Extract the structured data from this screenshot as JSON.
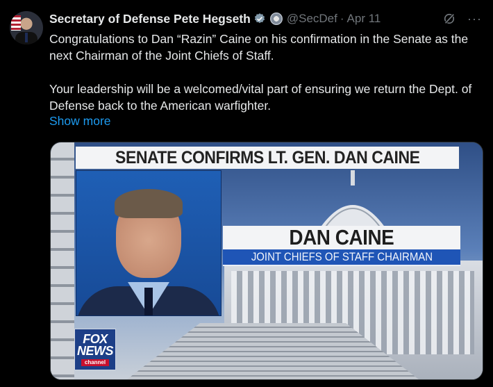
{
  "tweet": {
    "author_name": "Secretary of Defense Pete Hegseth",
    "handle": "@SecDef",
    "separator": "·",
    "date": "Apr 11",
    "paragraph_1": "Congratulations to Dan “Razin” Caine on his confirmation in the Senate as the next Chairman of the Joint Chiefs of Staff.",
    "paragraph_2": "Your leadership will be a welcomed/vital part of ensuring we return the Dept. of Defense back to the American warfighter.",
    "show_more": "Show more",
    "more_menu": "···"
  },
  "media": {
    "headline": "SENATE CONFIRMS LT. GEN. DAN CAINE",
    "name": "DAN CAINE",
    "title": "JOINT CHIEFS OF STAFF CHAIRMAN",
    "logo_line_1": "FOX",
    "logo_line_2": "NEWS",
    "logo_line_3": "channel"
  },
  "colors": {
    "background": "#000000",
    "text": "#e7e9ea",
    "muted": "#71767b",
    "link": "#1d9bf0",
    "verified": "#829aab"
  },
  "icons": [
    "avatar",
    "verified-badge-icon",
    "government-affiliation-icon",
    "grok-icon",
    "more-icon"
  ]
}
